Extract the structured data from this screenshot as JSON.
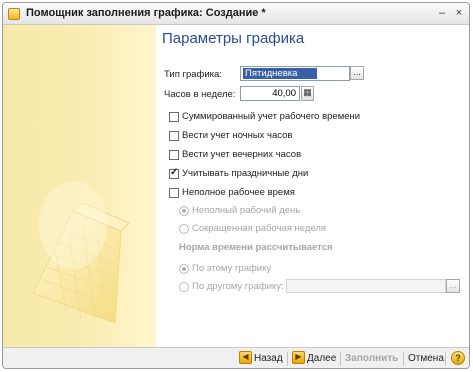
{
  "window": {
    "title": "Помощник заполнения графика: Создание *"
  },
  "page": {
    "heading": "Параметры графика"
  },
  "form": {
    "schedule_type_label": "Тип графика:",
    "schedule_type_value": "Пятидневка",
    "hours_label": "Часов в неделе:",
    "hours_value": "40,00",
    "browse_label": "..."
  },
  "checkboxes": [
    {
      "label": "Суммированный учет рабочего времени",
      "checked": false
    },
    {
      "label": "Вести учет ночных часов",
      "checked": false
    },
    {
      "label": "Вести учет вечерних часов",
      "checked": false
    },
    {
      "label": "Учитывать праздничные дни",
      "checked": true
    },
    {
      "label": "Неполное рабочее время",
      "checked": false
    }
  ],
  "part_time_radios": [
    {
      "label": "Неполный рабочий день",
      "selected": true
    },
    {
      "label": "Сокращенная рабочая неделя",
      "selected": false
    }
  ],
  "norm_heading": "Норма времени рассчитывается",
  "norm_radios": [
    {
      "label": "По этому графику",
      "selected": true
    },
    {
      "label": "По другому графику:",
      "selected": false
    }
  ],
  "other_schedule_value": "",
  "footer": {
    "back": "Назад",
    "next": "Далее",
    "fill": "Заполнить",
    "cancel": "Отмена",
    "help": "?"
  }
}
